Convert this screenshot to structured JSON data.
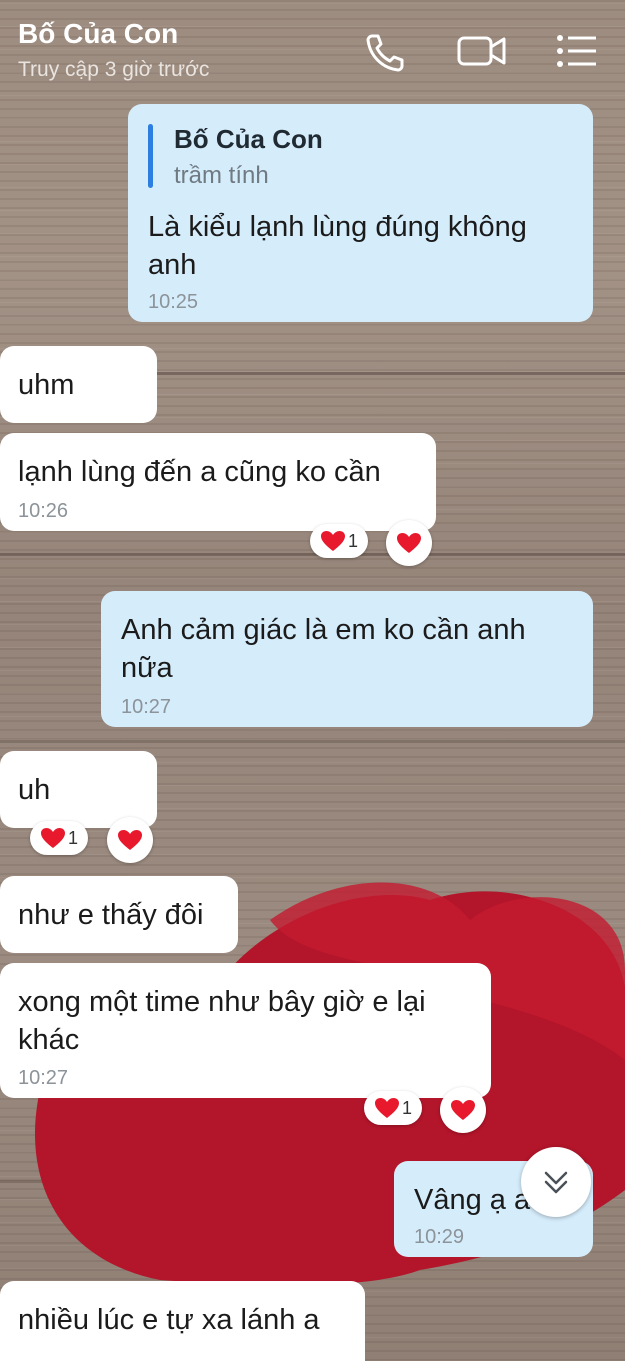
{
  "header": {
    "title": "Bố Của Con",
    "status": "Truy cập 3 giờ trước",
    "icons": [
      "phone-icon",
      "video-call-icon",
      "menu-list-icon"
    ]
  },
  "messages": [
    {
      "side": "out",
      "reply": {
        "name": "Bố Của Con",
        "text": "trầm tính"
      },
      "lines": [
        "Là kiểu lạnh lùng đúng không",
        "anh"
      ],
      "time": "10:25"
    },
    {
      "side": "in",
      "lines": [
        "uhm"
      ],
      "time": ""
    },
    {
      "side": "in",
      "lines": [
        "lạnh lùng đến a cũng ko cần"
      ],
      "time": "10:26",
      "reactions": {
        "count": "1"
      }
    },
    {
      "side": "out",
      "lines": [
        "Anh cảm giác là em ko cần anh",
        "nữa"
      ],
      "time": "10:27"
    },
    {
      "side": "in",
      "lines": [
        "uh"
      ],
      "time": "",
      "reactions": {
        "count": "1"
      }
    },
    {
      "side": "in",
      "lines": [
        "như e thấy đôi"
      ],
      "time": ""
    },
    {
      "side": "in",
      "lines": [
        "xong một time như bây giờ e lại",
        "khác"
      ],
      "time": "10:27",
      "reactions": {
        "count": "1"
      }
    },
    {
      "side": "out",
      "lines": [
        "Vâng ạ a"
      ],
      "time": "10:29"
    },
    {
      "side": "in",
      "lines": [
        "nhiều lúc e tự xa lánh a"
      ],
      "time": ""
    }
  ],
  "colors": {
    "incoming": "#ffffff",
    "outgoing": "#d5ecfb",
    "reply_accent": "#2c7fe0",
    "heart_reaction": "#e8192c"
  }
}
